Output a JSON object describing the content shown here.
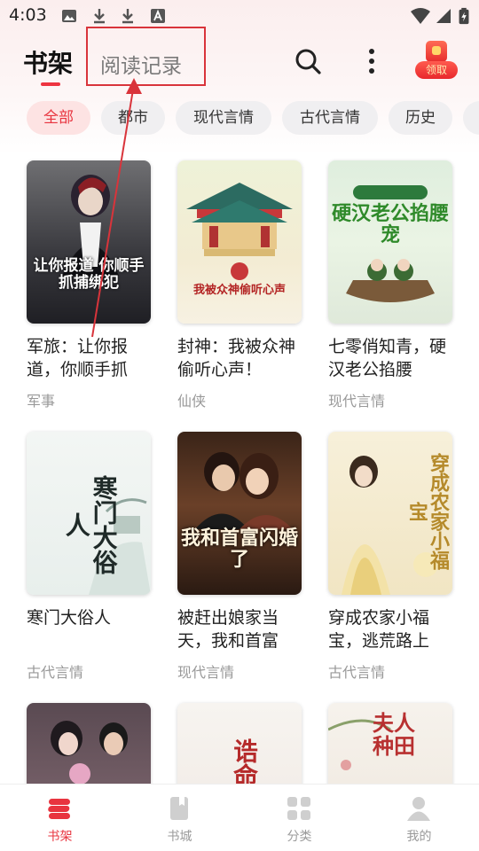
{
  "status_bar": {
    "time": "4:03"
  },
  "header": {
    "tabs": [
      {
        "label": "书架"
      },
      {
        "label": "阅读记录"
      }
    ],
    "gift_label": "领取"
  },
  "categories": [
    "全部",
    "都市",
    "现代言情",
    "古代言情",
    "历史"
  ],
  "books": [
    {
      "title": "军旅：让你报道，你顺手抓",
      "genre": "军事",
      "cover_text": "让你报道 你顺手抓捕绑犯"
    },
    {
      "title": "封神：我被众神偷听心声！",
      "genre": "仙侠",
      "cover_text": "我被众神偷听心声"
    },
    {
      "title": "七零俏知青，硬汉老公掐腰",
      "genre": "现代言情",
      "cover_text": "硬汉老公掐腰宠"
    },
    {
      "title": "寒门大俗人",
      "genre": "古代言情",
      "cover_text": "寒门大俗人"
    },
    {
      "title": "被赶出娘家当天，我和首富",
      "genre": "现代言情",
      "cover_text": "我和首富闪婚了"
    },
    {
      "title": "穿成农家小福宝，逃荒路上",
      "genre": "古代言情",
      "cover_text": "穿成农家小福宝"
    },
    {
      "title": "",
      "genre": "",
      "cover_text": ""
    },
    {
      "title": "",
      "genre": "",
      "cover_text": "诰命"
    },
    {
      "title": "",
      "genre": "",
      "cover_text": "夫人种田"
    }
  ],
  "bottom_nav": [
    {
      "label": "书架",
      "icon": "bookshelf-icon"
    },
    {
      "label": "书城",
      "icon": "bookstore-icon"
    },
    {
      "label": "分类",
      "icon": "category-grid-icon"
    },
    {
      "label": "我的",
      "icon": "profile-icon"
    }
  ],
  "colors": {
    "accent": "#e8343f",
    "annotation": "#d9343b"
  }
}
